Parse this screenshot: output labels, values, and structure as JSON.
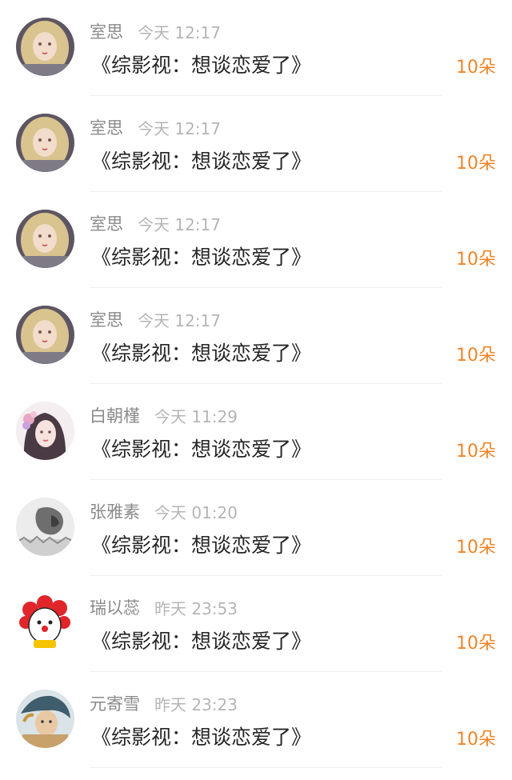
{
  "items": [
    {
      "name": "室思",
      "time": "今天 12:17",
      "title": "《综影视：想谈恋爱了》",
      "count": "10朵",
      "avatar": "blonde-girl-avatar"
    },
    {
      "name": "室思",
      "time": "今天 12:17",
      "title": "《综影视：想谈恋爱了》",
      "count": "10朵",
      "avatar": "blonde-girl-avatar"
    },
    {
      "name": "室思",
      "time": "今天 12:17",
      "title": "《综影视：想谈恋爱了》",
      "count": "10朵",
      "avatar": "blonde-girl-avatar"
    },
    {
      "name": "室思",
      "time": "今天 12:17",
      "title": "《综影视：想谈恋爱了》",
      "count": "10朵",
      "avatar": "blonde-girl-avatar"
    },
    {
      "name": "白朝槿",
      "time": "今天 11:29",
      "title": "《综影视：想谈恋爱了》",
      "count": "10朵",
      "avatar": "flower-girl-avatar"
    },
    {
      "name": "张雅素",
      "time": "今天 01:20",
      "title": "《综影视：想谈恋爱了》",
      "count": "10朵",
      "avatar": "lion-sketch-avatar"
    },
    {
      "name": "瑞以蕊",
      "time": "昨天 23:53",
      "title": "《综影视：想谈恋爱了》",
      "count": "10朵",
      "avatar": "clown-avatar"
    },
    {
      "name": "元寄雪",
      "time": "昨天 23:23",
      "title": "《综影视：想谈恋爱了》",
      "count": "10朵",
      "avatar": "anime-boy-avatar"
    }
  ]
}
